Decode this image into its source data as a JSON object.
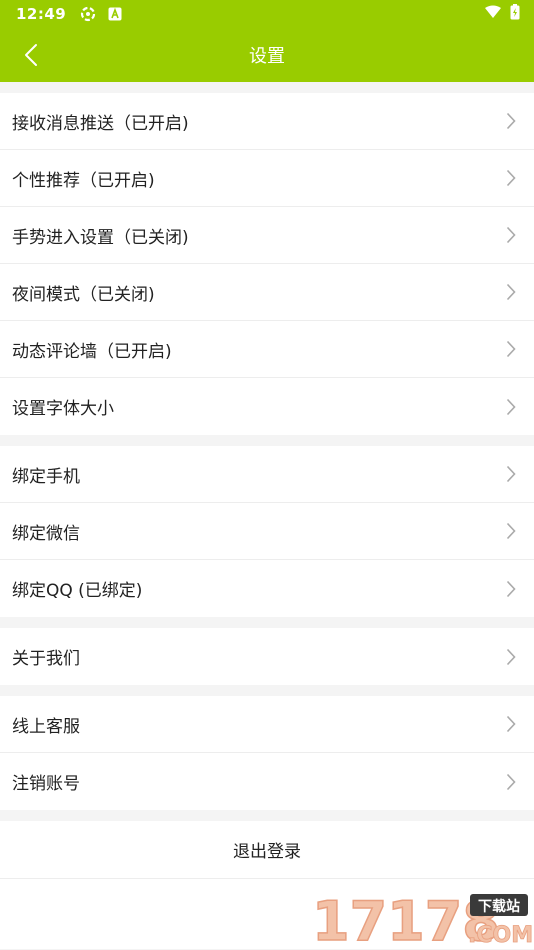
{
  "status_bar": {
    "time": "12:49",
    "icons": [
      "settings-gear-icon",
      "app-a-icon",
      "wifi-icon",
      "battery-icon"
    ]
  },
  "nav": {
    "title": "设置",
    "back_icon": "chevron-left-icon"
  },
  "groups": [
    {
      "items": [
        {
          "label": "接收消息推送（已开启)"
        },
        {
          "label": "个性推荐（已开启)"
        },
        {
          "label": "手势进入设置（已关闭)"
        },
        {
          "label": "夜间模式（已关闭)"
        },
        {
          "label": "动态评论墙（已开启)"
        },
        {
          "label": "设置字体大小"
        }
      ]
    },
    {
      "items": [
        {
          "label": "绑定手机"
        },
        {
          "label": "绑定微信"
        },
        {
          "label": "绑定QQ (已绑定)"
        }
      ]
    },
    {
      "items": [
        {
          "label": "关于我们"
        }
      ]
    },
    {
      "items": [
        {
          "label": "线上客服"
        },
        {
          "label": "注销账号"
        }
      ]
    }
  ],
  "logout": {
    "label": "退出登录"
  },
  "watermark": {
    "text": "17178",
    "badge": "下载站",
    "suffix": ".COM"
  },
  "colors": {
    "accent": "#99cc00",
    "text": "#222222",
    "chevron": "#aaaaaa",
    "background": "#f4f4f4"
  }
}
